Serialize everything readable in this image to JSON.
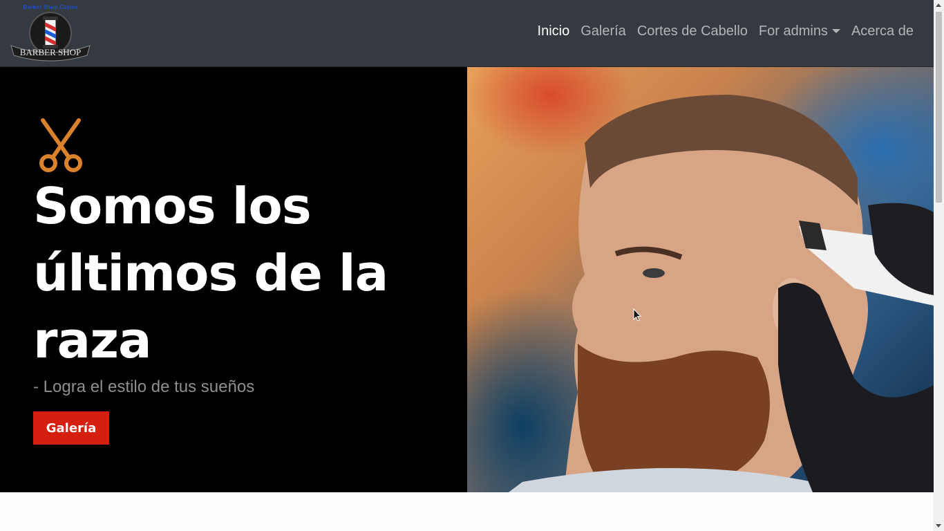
{
  "navbar": {
    "logo_caption": "Barber Shop Cortes",
    "logo_text": "BARBER SHOP",
    "links": [
      {
        "label": "Inicio"
      },
      {
        "label": "Galería"
      },
      {
        "label": "Cortes de Cabello"
      },
      {
        "label": "For admins"
      },
      {
        "label": "Acerca de"
      }
    ]
  },
  "hero": {
    "title": "Somos los últimos de la raza",
    "subtitle": "- Logra el estilo de tus sueños",
    "button_label": "Galería"
  },
  "colors": {
    "navbar_bg": "#343a40",
    "hero_bg": "#000000",
    "accent_red": "#d5200f",
    "scissors_orange": "#d9822b"
  },
  "icons": {
    "scissors": "scissors-icon",
    "dropdown": "chevron-down-icon"
  }
}
